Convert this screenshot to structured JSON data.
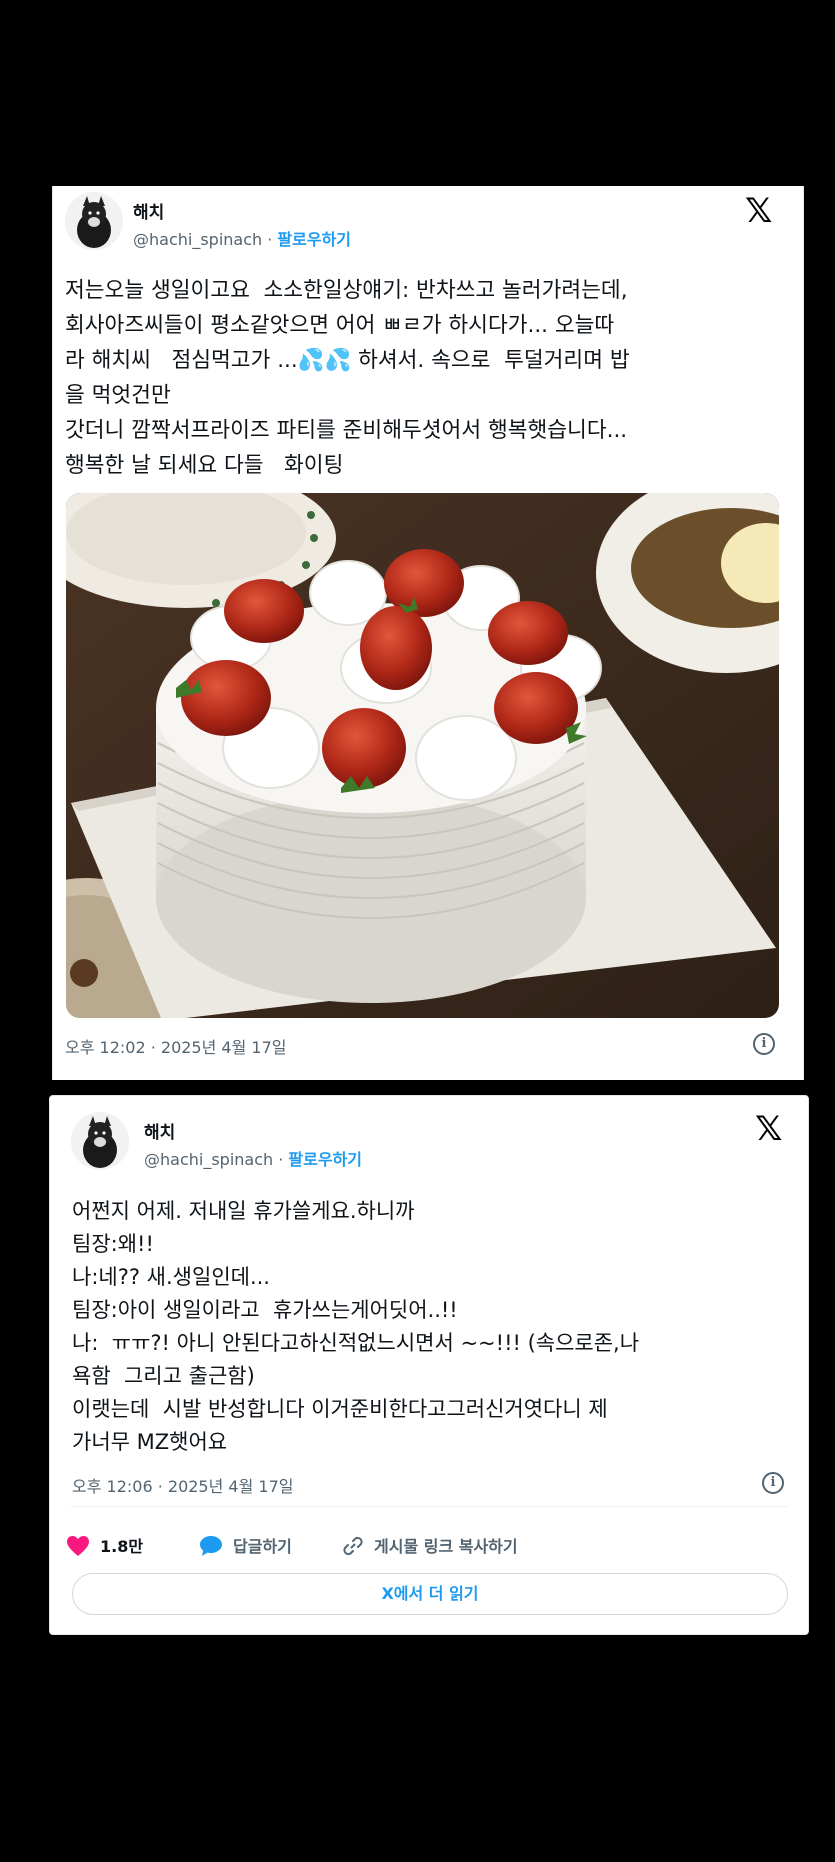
{
  "tweet1": {
    "name": "해치",
    "handle": "@hachi_spinach",
    "separator": " · ",
    "follow_label": "팔로우하기",
    "text": "저는오늘 생일이고요  소소한일상얘기: 반차쓰고 놀러가려는데,\n회사아즈씨들이 평소같앗으면 어어 ㅃㄹ가 하시다가... 오늘따\n라 해치씨   점심먹고가 ...💦💦 하셔서. 속으로  투덜거리며 밥\n을 먹엇건만\n갓더니 깜짝서프라이즈 파티를 준비해두셧어서 행복햇습니다...\n행복한 날 되세요 다들   화이팅",
    "timestamp": "오후 12:02 · 2025년 4월 17일"
  },
  "tweet2": {
    "name": "해치",
    "handle": "@hachi_spinach",
    "separator": " · ",
    "follow_label": "팔로우하기",
    "text": "어쩐지 어제. 저내일 휴가쓸게요.하니까\n팀장:왜!!\n나:네?? 새.생일인데...\n팀장:아이 생일이라고  휴가쓰는게어딧어..!!\n나:  ㅠㅠ?! 아니 안된다고하신적없느시면서 ~~!!! (속으로존,나\n욕함  그리고 출근함)\n이랫는데  시발 반성합니다 이거준비한다고그러신거엿다니 제\n가너무 MZ햇어요",
    "timestamp": "오후 12:06 · 2025년 4월 17일",
    "likes": "1.8만",
    "reply_label": "답글하기",
    "copy_link_label": "게시물 링크 복사하기",
    "read_more_label": "X에서 더 읽기"
  },
  "icons": {
    "x_logo": "𝕏",
    "info": "i",
    "heart_color": "#f91880",
    "accent": "#1d9bf0"
  }
}
